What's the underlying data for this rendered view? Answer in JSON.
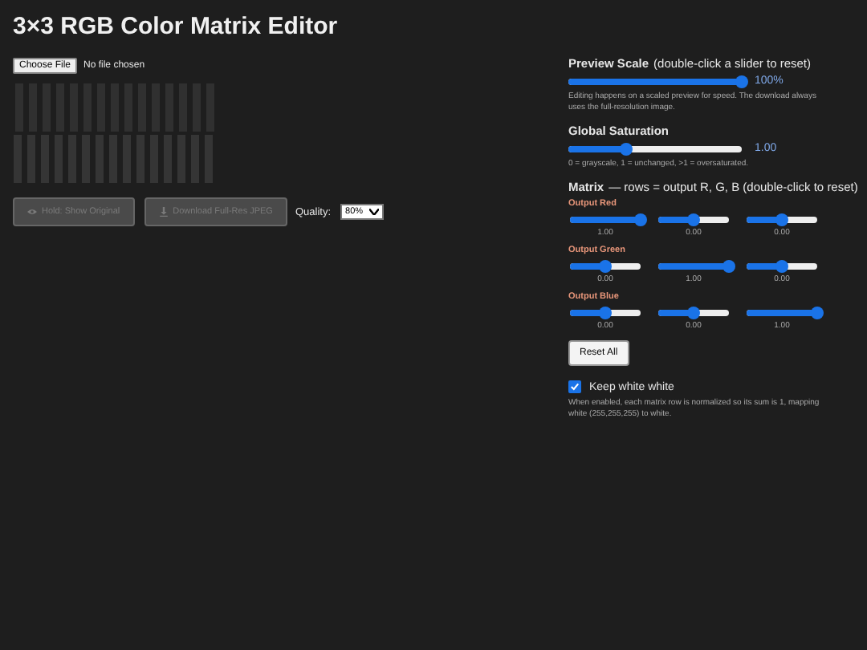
{
  "title": "3×3 RGB Color Matrix Editor",
  "file_input": {
    "button": "Choose File",
    "status": "No file chosen"
  },
  "actions": [
    {
      "kind": "eye",
      "label": "Hold: Show Original",
      "disabled": true
    },
    {
      "kind": "download",
      "label": "Download Full-Res JPEG",
      "disabled": true
    }
  ],
  "quality": {
    "label": "Quality:",
    "value": "80%"
  },
  "preview_scale": {
    "title": "Preview Scale",
    "hint": "(double-click a slider to reset)",
    "level": 1,
    "reading": "100%",
    "note": "Editing happens on a scaled preview for speed. The download always uses the full-resolution image."
  },
  "global_saturation": {
    "title": "Global Saturation",
    "level": 0.33,
    "reading": "1.00",
    "note": "0 = grayscale, 1 = unchanged, >1 = oversaturated."
  },
  "matrix": {
    "title": "Matrix",
    "hint": "— rows = output R, G, B (double-click to reset)",
    "rows": [
      {
        "label": "Output Red",
        "sliders": [
          {
            "level": 1,
            "reading": "1.00"
          },
          {
            "level": 0.5,
            "reading": "0.00"
          },
          {
            "level": 0.5,
            "reading": "0.00"
          }
        ]
      },
      {
        "label": "Output Green",
        "sliders": [
          {
            "level": 0.5,
            "reading": "0.00"
          },
          {
            "level": 1,
            "reading": "1.00"
          },
          {
            "level": 0.5,
            "reading": "0.00"
          }
        ]
      },
      {
        "label": "Output Blue",
        "sliders": [
          {
            "level": 0.5,
            "reading": "0.00"
          },
          {
            "level": 0.5,
            "reading": "0.00"
          },
          {
            "level": 1,
            "reading": "1.00"
          }
        ]
      }
    ]
  },
  "reset_button": "Reset All",
  "keep_white": {
    "label": "Keep white white",
    "checked": true,
    "note": "When enabled, each matrix row is normalized so its sum is 1, mapping white (255,255,255) to white."
  }
}
